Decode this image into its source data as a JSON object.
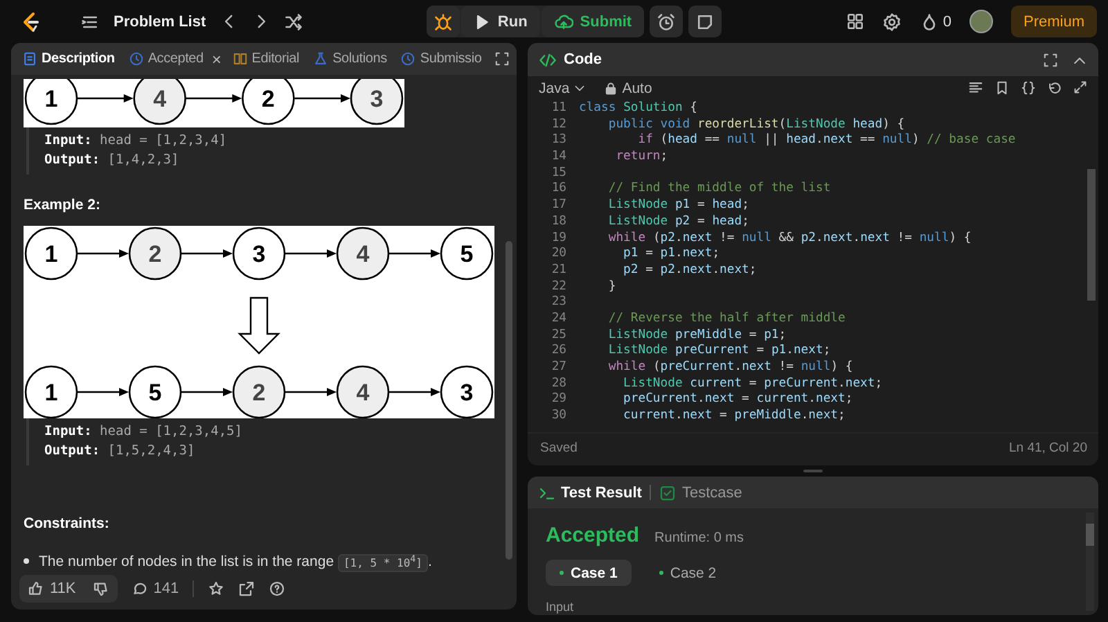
{
  "topbar": {
    "title": "Problem List",
    "run": "Run",
    "submit": "Submit",
    "streak": "0",
    "premium": "Premium"
  },
  "description_panel": {
    "tabs": [
      {
        "label": "Description",
        "selected": true
      },
      {
        "label": "Accepted",
        "selected": false,
        "close": "×"
      },
      {
        "label": "Editorial",
        "selected": false
      },
      {
        "label": "Solutions",
        "selected": false
      },
      {
        "label": "Submissio",
        "selected": false
      }
    ],
    "blocks": [
      {
        "kind": "diagram",
        "cropped": true,
        "rows": [
          [
            {
              "value": "1",
              "shaded": false
            },
            {
              "value": "4",
              "shaded": true
            },
            {
              "value": "2",
              "shaded": false
            },
            {
              "value": "3",
              "shaded": true
            }
          ]
        ]
      },
      {
        "kind": "io",
        "lines": [
          "**Input:** head = [1,2,3,4]",
          "**Output:** [1,4,2,3]"
        ]
      },
      {
        "kind": "heading",
        "text": "Example 2:"
      },
      {
        "kind": "diagram",
        "cropped": false,
        "rows": [
          [
            {
              "value": "1",
              "shaded": false
            },
            {
              "value": "2",
              "shaded": true
            },
            {
              "value": "3",
              "shaded": false
            },
            {
              "value": "4",
              "shaded": true
            },
            {
              "value": "5",
              "shaded": false
            }
          ],
          [
            {
              "value": "1",
              "shaded": false
            },
            {
              "value": "5",
              "shaded": false
            },
            {
              "value": "2",
              "shaded": true
            },
            {
              "value": "4",
              "shaded": true
            },
            {
              "value": "3",
              "shaded": false
            }
          ]
        ]
      },
      {
        "kind": "io",
        "lines": [
          "**Input:** head = [1,2,3,4,5]",
          "**Output:** [1,5,2,4,3]"
        ]
      },
      {
        "kind": "heading",
        "text": "Constraints:"
      },
      {
        "kind": "bullet",
        "text": "The number of nodes in the list is in the range ",
        "code": "[1, 5 * 10$^{4}$]",
        "after": "."
      }
    ],
    "footer": {
      "likes": "11K",
      "comments": "141"
    }
  },
  "code_panel": {
    "title": "Code",
    "language": "Java",
    "mode": "Auto",
    "status": "Saved",
    "cursor": "Ln 41, Col 20",
    "lines": [
      {
        "num": "11",
        "tokens": [
          {
            "kind": "kw",
            "text": "class "
          },
          {
            "kind": "type",
            "text": "Solution"
          },
          {
            "kind": "p",
            "text": " {"
          }
        ]
      },
      {
        "num": "12",
        "tokens": [
          {
            "kind": "kw",
            "text": "    public void "
          },
          {
            "kind": "fn",
            "text": "reorderList"
          },
          {
            "kind": "p",
            "text": "("
          },
          {
            "kind": "type",
            "text": "ListNode "
          },
          {
            "kind": "var",
            "text": "head"
          },
          {
            "kind": "p",
            "text": ") {"
          }
        ]
      },
      {
        "num": "13",
        "tokens": [
          {
            "kind": "ctrl",
            "text": "        if "
          },
          {
            "kind": "p",
            "text": "("
          },
          {
            "kind": "var",
            "text": "head"
          },
          {
            "kind": "p",
            "text": " == "
          },
          {
            "kind": "kw",
            "text": "null"
          },
          {
            "kind": "p",
            "text": " || "
          },
          {
            "kind": "var",
            "text": "head"
          },
          {
            "kind": "p",
            "text": "."
          },
          {
            "kind": "var",
            "text": "next"
          },
          {
            "kind": "p",
            "text": " == "
          },
          {
            "kind": "kw",
            "text": "null"
          },
          {
            "kind": "p",
            "text": ") "
          },
          {
            "kind": "cm",
            "text": "// base case"
          }
        ]
      },
      {
        "num": "14",
        "tokens": [
          {
            "kind": "ctrl",
            "text": "     return"
          },
          {
            "kind": "p",
            "text": ";"
          }
        ]
      },
      {
        "num": "15"
      },
      {
        "num": "16",
        "tokens": [
          {
            "kind": "cm",
            "text": "    // Find the middle of the list"
          }
        ]
      },
      {
        "num": "17",
        "tokens": [
          {
            "kind": "type",
            "text": "    ListNode "
          },
          {
            "kind": "var",
            "text": "p1"
          },
          {
            "kind": "p",
            "text": " = "
          },
          {
            "kind": "var",
            "text": "head"
          },
          {
            "kind": "p",
            "text": ";"
          }
        ]
      },
      {
        "num": "18",
        "tokens": [
          {
            "kind": "type",
            "text": "    ListNode "
          },
          {
            "kind": "var",
            "text": "p2"
          },
          {
            "kind": "p",
            "text": " = "
          },
          {
            "kind": "var",
            "text": "head"
          },
          {
            "kind": "p",
            "text": ";"
          }
        ]
      },
      {
        "num": "19",
        "tokens": [
          {
            "kind": "ctrl",
            "text": "    while "
          },
          {
            "kind": "p",
            "text": "("
          },
          {
            "kind": "var",
            "text": "p2"
          },
          {
            "kind": "p",
            "text": "."
          },
          {
            "kind": "var",
            "text": "next"
          },
          {
            "kind": "p",
            "text": " != "
          },
          {
            "kind": "kw",
            "text": "null"
          },
          {
            "kind": "p",
            "text": " && "
          },
          {
            "kind": "var",
            "text": "p2"
          },
          {
            "kind": "p",
            "text": "."
          },
          {
            "kind": "var",
            "text": "next"
          },
          {
            "kind": "p",
            "text": "."
          },
          {
            "kind": "var",
            "text": "next"
          },
          {
            "kind": "p",
            "text": " != "
          },
          {
            "kind": "kw",
            "text": "null"
          },
          {
            "kind": "p",
            "text": ") {"
          }
        ]
      },
      {
        "num": "20",
        "tokens": [
          {
            "kind": "var",
            "text": "      p1"
          },
          {
            "kind": "p",
            "text": " = "
          },
          {
            "kind": "var",
            "text": "p1"
          },
          {
            "kind": "p",
            "text": "."
          },
          {
            "kind": "var",
            "text": "next"
          },
          {
            "kind": "p",
            "text": ";"
          }
        ]
      },
      {
        "num": "21",
        "tokens": [
          {
            "kind": "var",
            "text": "      p2"
          },
          {
            "kind": "p",
            "text": " = "
          },
          {
            "kind": "var",
            "text": "p2"
          },
          {
            "kind": "p",
            "text": "."
          },
          {
            "kind": "var",
            "text": "next"
          },
          {
            "kind": "p",
            "text": "."
          },
          {
            "kind": "var",
            "text": "next"
          },
          {
            "kind": "p",
            "text": ";"
          }
        ]
      },
      {
        "num": "22",
        "tokens": [
          {
            "kind": "p",
            "text": "    }"
          }
        ]
      },
      {
        "num": "23"
      },
      {
        "num": "24",
        "tokens": [
          {
            "kind": "cm",
            "text": "    // Reverse the half after middle"
          }
        ]
      },
      {
        "num": "25",
        "tokens": [
          {
            "kind": "type",
            "text": "    ListNode "
          },
          {
            "kind": "var",
            "text": "preMiddle"
          },
          {
            "kind": "p",
            "text": " = "
          },
          {
            "kind": "var",
            "text": "p1"
          },
          {
            "kind": "p",
            "text": ";"
          }
        ]
      },
      {
        "num": "26",
        "tokens": [
          {
            "kind": "type",
            "text": "    ListNode "
          },
          {
            "kind": "var",
            "text": "preCurrent"
          },
          {
            "kind": "p",
            "text": " = "
          },
          {
            "kind": "var",
            "text": "p1"
          },
          {
            "kind": "p",
            "text": "."
          },
          {
            "kind": "var",
            "text": "next"
          },
          {
            "kind": "p",
            "text": ";"
          }
        ]
      },
      {
        "num": "27",
        "tokens": [
          {
            "kind": "ctrl",
            "text": "    while "
          },
          {
            "kind": "p",
            "text": "("
          },
          {
            "kind": "var",
            "text": "preCurrent"
          },
          {
            "kind": "p",
            "text": "."
          },
          {
            "kind": "var",
            "text": "next"
          },
          {
            "kind": "p",
            "text": " != "
          },
          {
            "kind": "kw",
            "text": "null"
          },
          {
            "kind": "p",
            "text": ") {"
          }
        ]
      },
      {
        "num": "28",
        "tokens": [
          {
            "kind": "type",
            "text": "      ListNode "
          },
          {
            "kind": "var",
            "text": "current"
          },
          {
            "kind": "p",
            "text": " = "
          },
          {
            "kind": "var",
            "text": "preCurrent"
          },
          {
            "kind": "p",
            "text": "."
          },
          {
            "kind": "var",
            "text": "next"
          },
          {
            "kind": "p",
            "text": ";"
          }
        ]
      },
      {
        "num": "29",
        "tokens": [
          {
            "kind": "var",
            "text": "      preCurrent"
          },
          {
            "kind": "p",
            "text": "."
          },
          {
            "kind": "var",
            "text": "next"
          },
          {
            "kind": "p",
            "text": " = "
          },
          {
            "kind": "var",
            "text": "current"
          },
          {
            "kind": "p",
            "text": "."
          },
          {
            "kind": "var",
            "text": "next"
          },
          {
            "kind": "p",
            "text": ";"
          }
        ]
      },
      {
        "num": "30",
        "tokens": [
          {
            "kind": "var",
            "text": "      current"
          },
          {
            "kind": "p",
            "text": "."
          },
          {
            "kind": "var",
            "text": "next"
          },
          {
            "kind": "p",
            "text": " = "
          },
          {
            "kind": "var",
            "text": "preMiddle"
          },
          {
            "kind": "p",
            "text": "."
          },
          {
            "kind": "var",
            "text": "next"
          },
          {
            "kind": "p",
            "text": ";"
          }
        ]
      }
    ]
  },
  "test_panel": {
    "tabs": [
      {
        "label": "Test Result",
        "selected": true
      },
      {
        "label": "Testcase",
        "selected": false
      }
    ],
    "verdict": "Accepted",
    "runtime": "Runtime: 0 ms",
    "cases": [
      {
        "label": "Case 1",
        "selected": true
      },
      {
        "label": "Case 2",
        "selected": false
      }
    ],
    "section_label": "Input"
  }
}
